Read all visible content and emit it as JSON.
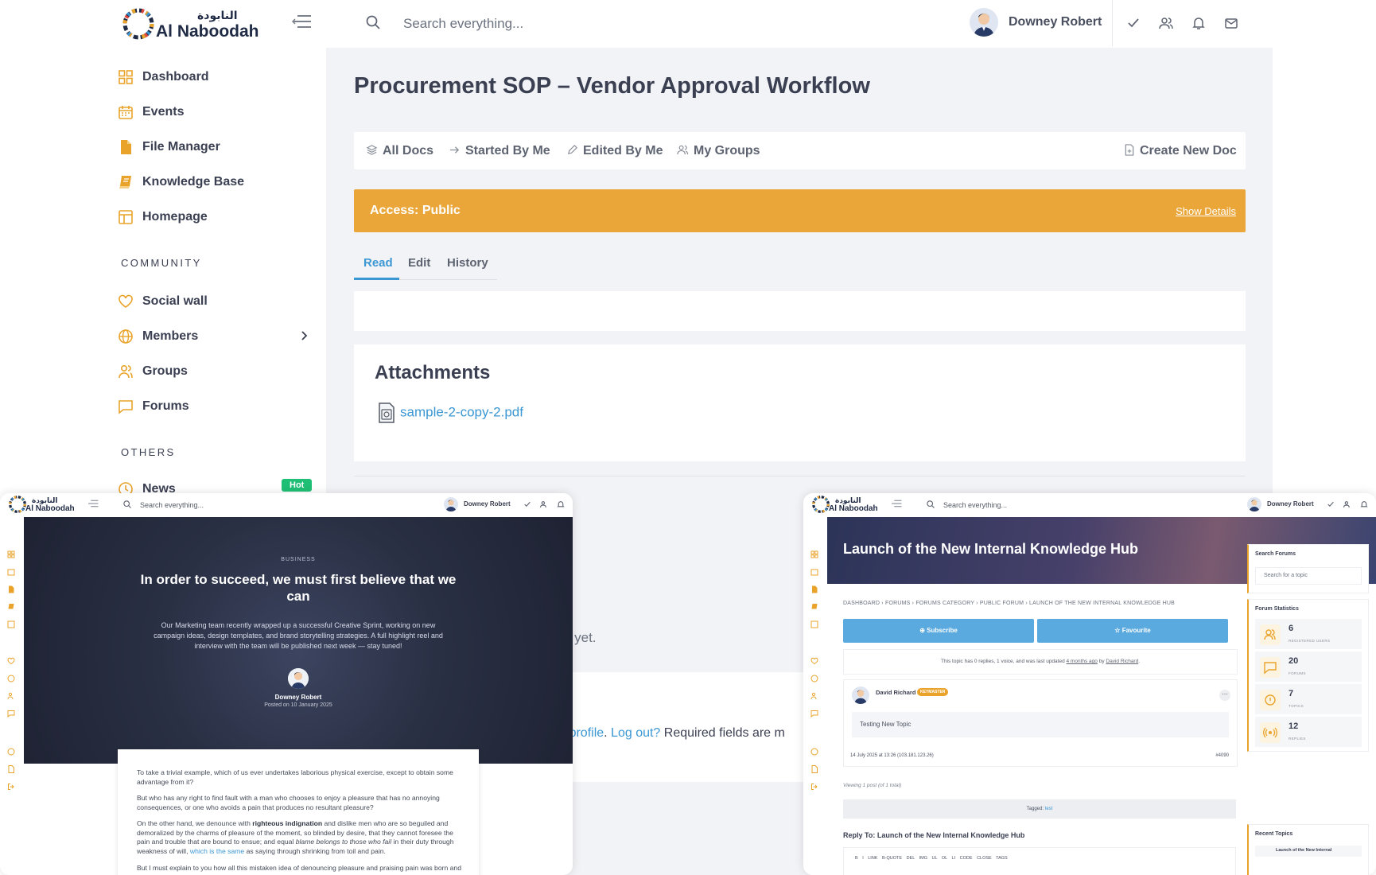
{
  "brand": {
    "name": "Al Naboodah",
    "arabic": "النابودة"
  },
  "colors": {
    "accent": "#eaa638",
    "link": "#3b97d3",
    "badge": "#1fbf75"
  },
  "header": {
    "search_placeholder": "Search everything...",
    "user_name": "Downey Robert",
    "icons": [
      "check-icon",
      "users-icon",
      "bell-icon",
      "mail-icon"
    ]
  },
  "sidebar": {
    "items": [
      {
        "label": "Dashboard",
        "icon": "grid-icon"
      },
      {
        "label": "Events",
        "icon": "calendar-icon"
      },
      {
        "label": "File Manager",
        "icon": "file-icon"
      },
      {
        "label": "Knowledge Base",
        "icon": "book-icon"
      },
      {
        "label": "Homepage",
        "icon": "layout-icon"
      }
    ],
    "community_title": "COMMUNITY",
    "community": [
      {
        "label": "Social wall",
        "icon": "heart-icon"
      },
      {
        "label": "Members",
        "icon": "globe-icon"
      },
      {
        "label": "Groups",
        "icon": "users-icon"
      },
      {
        "label": "Forums",
        "icon": "chat-icon"
      }
    ],
    "others_title": "OTHERS",
    "others": [
      {
        "label": "News",
        "icon": "clock-icon",
        "badge": "Hot"
      }
    ]
  },
  "page": {
    "title": "Procurement SOP – Vendor Approval Workflow",
    "filters": [
      "All Docs",
      "Started By Me",
      "Edited By Me",
      "My Groups"
    ],
    "create_label": "Create New Doc",
    "access_label": "Access: Public",
    "show_details": "Show Details",
    "tabs": [
      "Read",
      "Edit",
      "History"
    ],
    "active_tab": "Read",
    "attachments_title": "Attachments",
    "attachment_file": "sample-2-copy-2.pdf",
    "empty_text": "doc yet.",
    "login_profile": "your profile",
    "login_sep": ". ",
    "login_logout": "Log out?",
    "login_required": " Required fields are m"
  },
  "mini1": {
    "category": "BUSINESS",
    "title": "In order to succeed, we must first believe that we can",
    "intro": "Our Marketing team recently wrapped up a successful Creative Sprint, working on new campaign ideas, design templates, and brand storytelling strategies. A full highlight reel and interview with the team will be published next week — stay tuned!",
    "author": "Downey Robert",
    "date": "Posted on 10 January 2025",
    "para1": "To take a trivial example, which of us ever undertakes laborious physical exercise, except to obtain some advantage from it?",
    "para2": "But who has any right to find fault with a man who chooses to enjoy a pleasure that has no annoying consequences, or one who avoids a pain that produces no resultant pleasure?",
    "para3_a": "On the other hand, we denounce with ",
    "para3_b": "righteous indignation",
    "para3_c": " and dislike men who are so beguiled and demoralized by the charms of pleasure of the moment, so blinded by desire, that they cannot foresee the pain and trouble that are bound to ensue; and equal ",
    "para3_d": "blame belongs to those who fail",
    "para3_e": " in their duty through weakness of will, ",
    "para3_f": "which is the same",
    "para3_g": " as saying through shrinking from toil and pain.",
    "para4": "But I must explain to you how all this mistaken idea of denouncing pleasure and praising pain was born and"
  },
  "mini2": {
    "title": "Launch of the New Internal Knowledge Hub",
    "breadcrumb": "DASHBOARD  ›  FORUMS  ›  FORUMS CATEGORY  ›  PUBLIC FORUM  ›  LAUNCH OF THE NEW INTERNAL KNOWLEDGE HUB",
    "subscribe": "⊕ Subscribe",
    "favourite": "☆ Favourite",
    "info_a": "This topic has 0 replies, 1 voice, and was last updated ",
    "info_b": "4 months ago",
    "info_c": " by ",
    "info_d": "David Richard",
    "info_e": ".",
    "poster": "David Richard",
    "poster_role": "KEYMASTER",
    "post_body": "Testing New Topic",
    "post_meta": "14 July 2025 at 13:26   (103.181.123.26)",
    "post_id": "#4090",
    "viewing": "Viewing 1 post (of 1 total)",
    "tagged": "Tagged: ",
    "tag": "test",
    "reply_title": "Reply To: Launch of the New Internal Knowledge Hub",
    "toolbar": "B   I   LINK  B-QUOTE  DEL  IMG  UL  OL  LI  CODE  CLOSE TAGS",
    "search_title": "Search Forums",
    "search_placeholder": "Search for a topic",
    "stats_title": "Forum Statistics",
    "stats": [
      {
        "value": "6",
        "label": "REGISTERED USERS"
      },
      {
        "value": "20",
        "label": "FORUMS"
      },
      {
        "value": "7",
        "label": "TOPICS"
      },
      {
        "value": "12",
        "label": "REPLIES"
      }
    ],
    "recent_title": "Recent Topics",
    "recent_item": "Launch of the New Internal"
  }
}
